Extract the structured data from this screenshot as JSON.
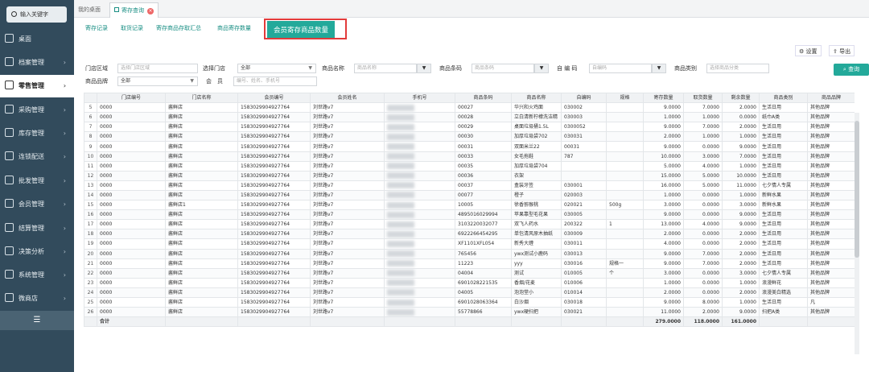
{
  "sidebar": {
    "search_label": "输入关键字",
    "items": [
      {
        "label": "桌面"
      },
      {
        "label": "档案管理"
      },
      {
        "label": "零售管理"
      },
      {
        "label": "采购管理"
      },
      {
        "label": "库存管理"
      },
      {
        "label": "连锁配送"
      },
      {
        "label": "批发管理"
      },
      {
        "label": "会员管理"
      },
      {
        "label": "结算管理"
      },
      {
        "label": "决策分析"
      },
      {
        "label": "系统管理"
      },
      {
        "label": "微商店"
      }
    ],
    "chevron": "›",
    "collapse_icon": "☰"
  },
  "page_tabs": [
    {
      "label": "我的桌面"
    },
    {
      "label": "寄存查询",
      "close": "×"
    }
  ],
  "sub_tabs": [
    "寄存记录",
    "取货记录",
    "寄存商品存取汇总",
    "商品寄存数量",
    "会员寄存商品数量"
  ],
  "toolbar": {
    "settings_label": "设置",
    "export_label": "导出"
  },
  "filters": {
    "store_region_label": "门店区域",
    "store_region_placeholder": "选择门店区域",
    "store_label": "选择门店",
    "store_value": "全部",
    "product_name_label": "商品名称",
    "product_name_placeholder": "商品名称",
    "barcode_label": "商品条码",
    "barcode_placeholder": "商品条码",
    "selfcode_label": "自 编 码",
    "selfcode_placeholder": "自编码",
    "category_label": "商品类别",
    "category_placeholder": "选择商品分类",
    "brand_label": "商品品牌",
    "brand_value": "全部",
    "member_label": "会　员",
    "member_placeholder": "编号、姓名、手机号",
    "filter_icon": "▼",
    "query_label": "查询"
  },
  "table": {
    "columns": [
      "",
      "门店编号",
      "门店名称",
      "会员编号",
      "会员姓名",
      "手机号",
      "商品条码",
      "商品名称",
      "自编码",
      "规格",
      "寄存数量",
      "取货数量",
      "剩余数量",
      "商品类别",
      "商品品牌"
    ],
    "rows": [
      [
        "5",
        "0000",
        "酱鲜店",
        "1583029904927764",
        "刘世路v7",
        "",
        "00027",
        "华兴和火鸡面",
        "030002",
        "",
        "9.0000",
        "7.0000",
        "2.0000",
        "生活日用",
        "其他品牌"
      ],
      [
        "6",
        "0000",
        "酱鲜店",
        "1583029904927764",
        "刘世路v7",
        "",
        "00028",
        "立白清新柠檬洗洁精",
        "030003",
        "",
        "1.0000",
        "1.0000",
        "0.0000",
        "纸巾A类",
        "其他品牌"
      ],
      [
        "7",
        "0000",
        "酱鲜店",
        "1583029904927764",
        "刘世路v7",
        "",
        "00029",
        "桌面垃圾桶1.5L",
        "0300052",
        "",
        "9.0000",
        "7.0000",
        "2.0000",
        "生活日用",
        "其他品牌"
      ],
      [
        "8",
        "0000",
        "酱鲜店",
        "1583029904927764",
        "刘世路v7",
        "",
        "00030",
        "加厚垃圾袋702",
        "030031",
        "",
        "2.0000",
        "1.0000",
        "1.0000",
        "生活日用",
        "其他品牌"
      ],
      [
        "9",
        "0000",
        "酱鲜店",
        "1583029904927764",
        "刘世路v7",
        "",
        "00031",
        "双面米兰22",
        "00031",
        "",
        "9.0000",
        "0.0000",
        "9.0000",
        "生活日用",
        "其他品牌"
      ],
      [
        "10",
        "0000",
        "酱鲜店",
        "1583029904927764",
        "刘世路v7",
        "",
        "00033",
        "女毛拖鞋",
        "787",
        "",
        "10.0000",
        "3.0000",
        "7.0000",
        "生活日用",
        "其他品牌"
      ],
      [
        "11",
        "0000",
        "酱鲜店",
        "1583029904927764",
        "刘世路v7",
        "",
        "00035",
        "加厚垃圾袋704",
        "",
        "",
        "5.0000",
        "4.0000",
        "1.0000",
        "生活日用",
        "其他品牌"
      ],
      [
        "12",
        "0000",
        "酱鲜店",
        "1583029904927764",
        "刘世路v7",
        "",
        "00036",
        "衣架",
        "",
        "",
        "15.0000",
        "5.0000",
        "10.0000",
        "生活日用",
        "其他品牌"
      ],
      [
        "13",
        "0000",
        "酱鲜店",
        "1583029904927764",
        "刘世路v7",
        "",
        "00037",
        "盒装牙签",
        "030001",
        "",
        "16.0000",
        "5.0000",
        "11.0000",
        "七夕情人专属",
        "其他品牌"
      ],
      [
        "14",
        "0000",
        "酱鲜店",
        "1583029904927764",
        "刘世路v7",
        "",
        "00077",
        "橙子",
        "020003",
        "",
        "1.0000",
        "0.0000",
        "1.0000",
        "新鲜水果",
        "其他品牌"
      ],
      [
        "15",
        "0000",
        "酱鲜店1",
        "1583029904927764",
        "刘世路v7",
        "",
        "10005",
        "徐香猕猴桃",
        "020021",
        "500g",
        "3.0000",
        "0.0000",
        "3.0000",
        "新鲜水果",
        "其他品牌"
      ],
      [
        "16",
        "0000",
        "酱鲜店",
        "1583029904927764",
        "刘世路v7",
        "",
        "4895016029994",
        "苹果靠型毛花果",
        "030005",
        "",
        "9.0000",
        "0.0000",
        "9.0000",
        "生活日用",
        "其他品牌"
      ],
      [
        "17",
        "0000",
        "酱鲜店",
        "1583029904927764",
        "刘世路v7",
        "",
        "3103220032077",
        "双飞人药水",
        "200322",
        "1",
        "13.0000",
        "4.0000",
        "9.0000",
        "生活日用",
        "其他品牌"
      ],
      [
        "18",
        "0000",
        "酱鲜店",
        "1583029904927764",
        "刘世路v7",
        "",
        "6922266454295",
        "单包清风原木抽纸",
        "030009",
        "",
        "2.0000",
        "0.0000",
        "2.0000",
        "生活日用",
        "其他品牌"
      ],
      [
        "19",
        "0000",
        "酱鲜店",
        "1583029904927764",
        "刘世路v7",
        "",
        "XF1101XFL054",
        "新秀大缠",
        "030011",
        "",
        "4.0000",
        "0.0000",
        "2.0000",
        "生活日用",
        "其他品牌"
      ],
      [
        "20",
        "0000",
        "酱鲜店",
        "1583029904927764",
        "刘世路v7",
        "",
        "765456",
        "ywx测试小鹿码",
        "030013",
        "",
        "9.0000",
        "7.0000",
        "2.0000",
        "生活日用",
        "其他品牌"
      ],
      [
        "21",
        "0000",
        "酱鲜店",
        "1583029904927764",
        "刘世路v7",
        "",
        "11223",
        "yyy",
        "030016",
        "规格一",
        "9.0000",
        "7.0000",
        "2.0000",
        "生活日用",
        "其他品牌"
      ],
      [
        "22",
        "0000",
        "酱鲜店",
        "1583029904927764",
        "刘世路v7",
        "",
        "04004",
        "测试",
        "010005",
        "个",
        "3.0000",
        "0.0000",
        "3.0000",
        "七夕情人专属",
        "其他品牌"
      ],
      [
        "23",
        "0000",
        "酱鲜店",
        "1583029904927764",
        "刘世路v7",
        "",
        "6901028221535",
        "香烟/花麦",
        "010006",
        "",
        "1.0000",
        "0.0000",
        "1.0000",
        "浪漫鲜花",
        "其他品牌"
      ],
      [
        "24",
        "0000",
        "酱鲜店",
        "1583029904927764",
        "刘世路v7",
        "",
        "04005",
        "泡泡堂小",
        "010014",
        "",
        "2.0000",
        "0.0000",
        "2.0000",
        "浪漫美白精选",
        "其他品牌"
      ],
      [
        "25",
        "0000",
        "酱鲜店",
        "1583029904927764",
        "刘世路v7",
        "",
        "6901028063364",
        "白沙烟",
        "030018",
        "",
        "9.0000",
        "8.0000",
        "1.0000",
        "生活日用",
        "凡"
      ],
      [
        "26",
        "0000",
        "酱鲜店",
        "1583029904927764",
        "刘世路v7",
        "",
        "55778866",
        "ywx硬扫把",
        "030021",
        "",
        "11.0000",
        "2.0000",
        "9.0000",
        "扫把A类",
        "其他品牌"
      ]
    ],
    "total": {
      "label": "合计",
      "deposit": "279.0000",
      "pickup": "118.0000",
      "remaining": "161.0000"
    }
  }
}
